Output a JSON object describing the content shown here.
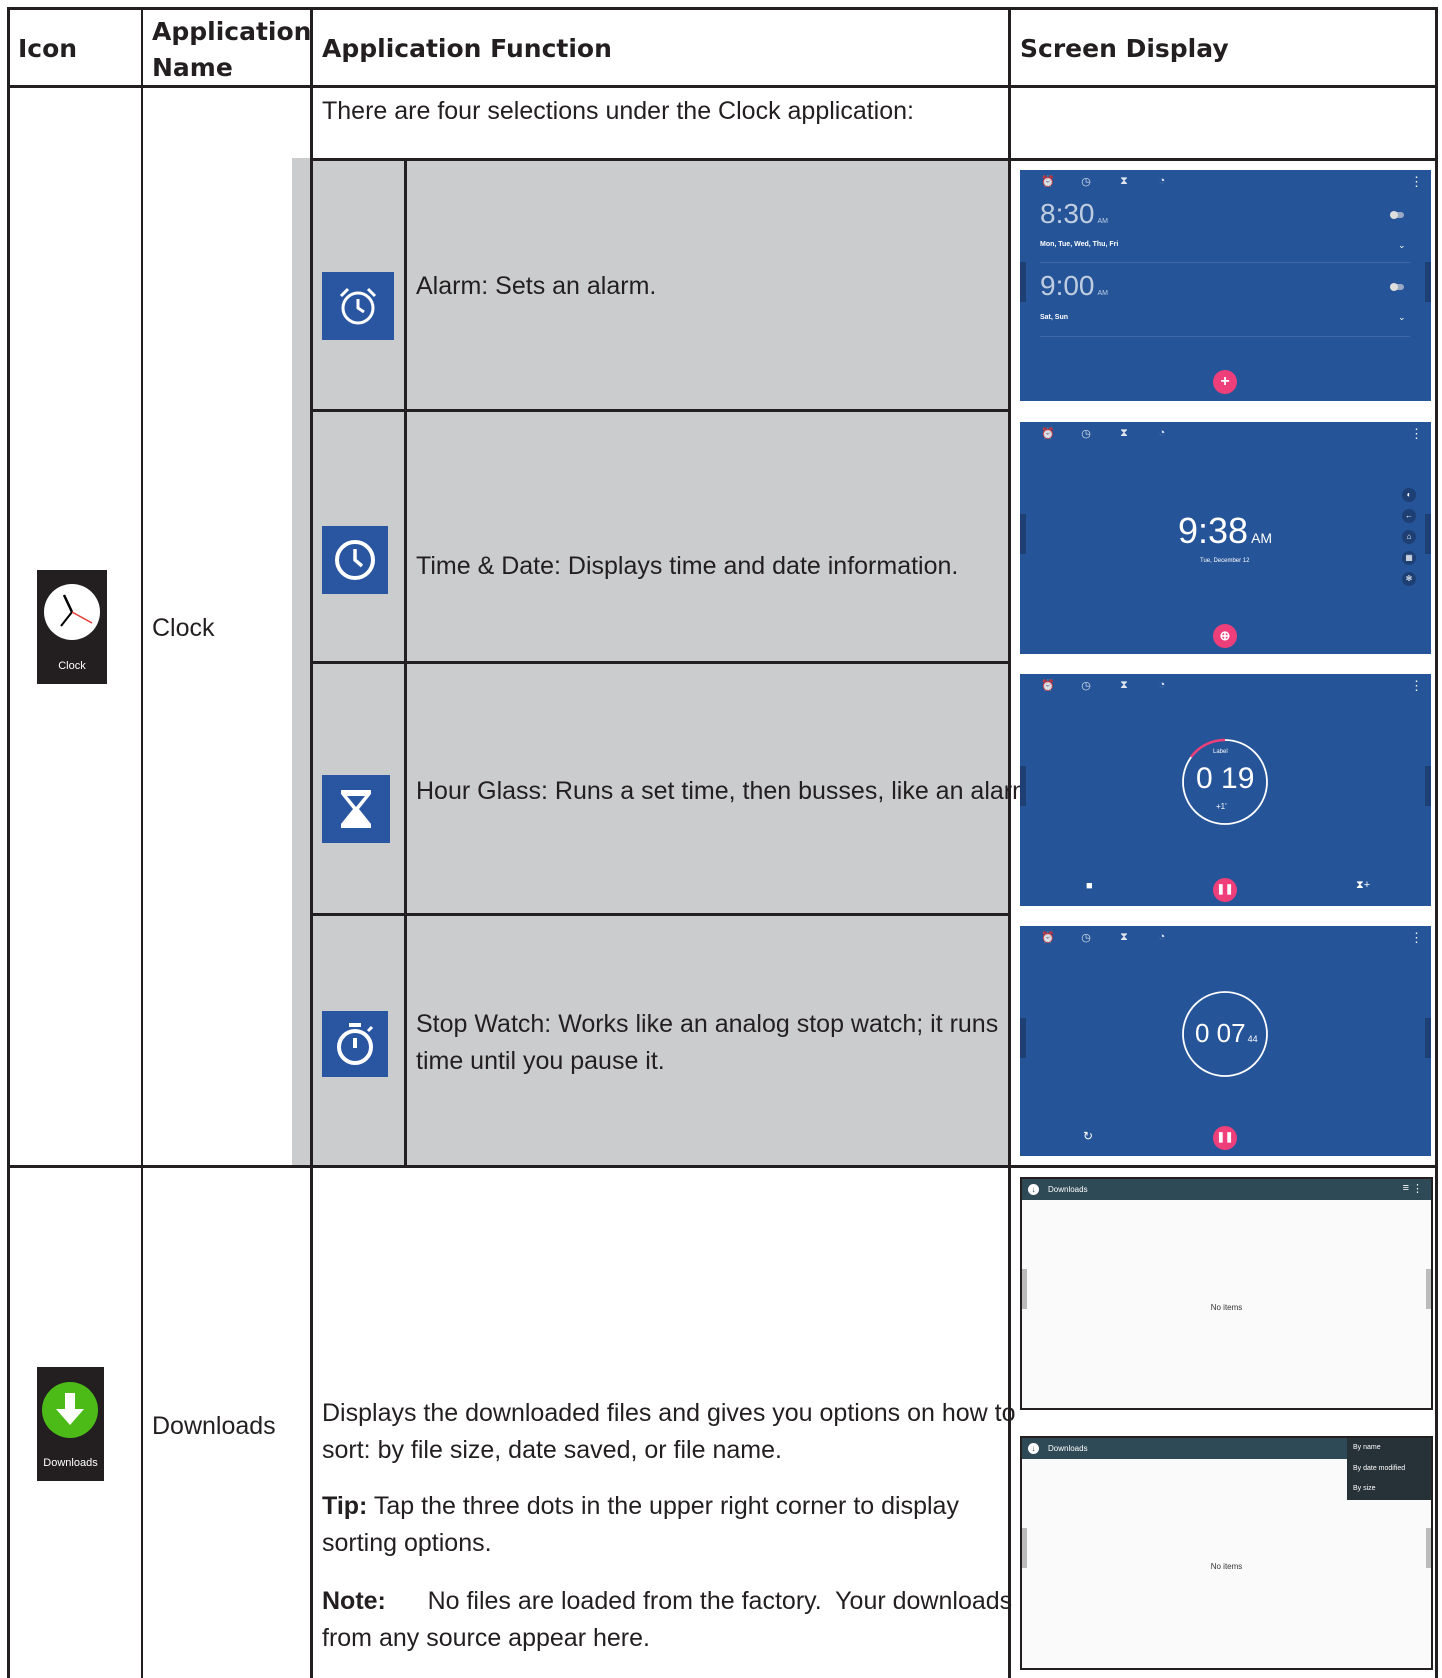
{
  "header": {
    "icon": "Icon",
    "app_name_l1": "Application",
    "app_name_l2": "Name",
    "function": "Application Function",
    "screen": "Screen Display"
  },
  "clock_row": {
    "tile_label": "Clock",
    "app_name": "Clock",
    "intro": "There are four selections under the Clock application:",
    "selections": [
      {
        "icon": "alarm-clock-icon",
        "text": "Alarm:  Sets an alarm."
      },
      {
        "icon": "clock-icon",
        "text": "Time & Date: Displays time and date information."
      },
      {
        "icon": "hourglass-icon",
        "text": "Hour Glass: Runs a set time, then busses, like an alarm."
      },
      {
        "icon": "stopwatch-icon",
        "line1": "Stop Watch: Works like an analog stop watch; it runs",
        "line2": "time until you pause it."
      }
    ],
    "alarm_screen": {
      "alarms": [
        {
          "time": "8:30",
          "ampm": "AM",
          "days": "Mon, Tue, Wed, Thu, Fri"
        },
        {
          "time": "9:00",
          "ampm": "AM",
          "days": "Sat, Sun"
        }
      ],
      "fab": "+"
    },
    "time_screen": {
      "time": "9:38",
      "ampm": "AM",
      "date": "Tue, December 12"
    },
    "timer_screen": {
      "label": "Label",
      "time": "0 19",
      "add": "+1'"
    },
    "stopwatch_screen": {
      "time": "0 07",
      "hundredths": "44"
    }
  },
  "downloads_row": {
    "tile_label": "Downloads",
    "app_name": "Downloads",
    "line1": "Displays the downloaded files and gives you options on how to",
    "line2": "sort: by file size, date saved, or file name.",
    "tip_label": "Tip:",
    "tip_line1": " Tap the three dots in the upper right corner to display",
    "tip_line2": "sorting options.",
    "note_label": "Note:",
    "note_line1": "      No files are loaded from the factory.  Your downloads",
    "note_line2": "from any source appear here.",
    "screen1": {
      "title": "Downloads",
      "empty": "No items"
    },
    "screen2": {
      "title": "Downloads",
      "empty": "No items",
      "sort_options": [
        "By name",
        "By date modified",
        "By size"
      ]
    }
  }
}
